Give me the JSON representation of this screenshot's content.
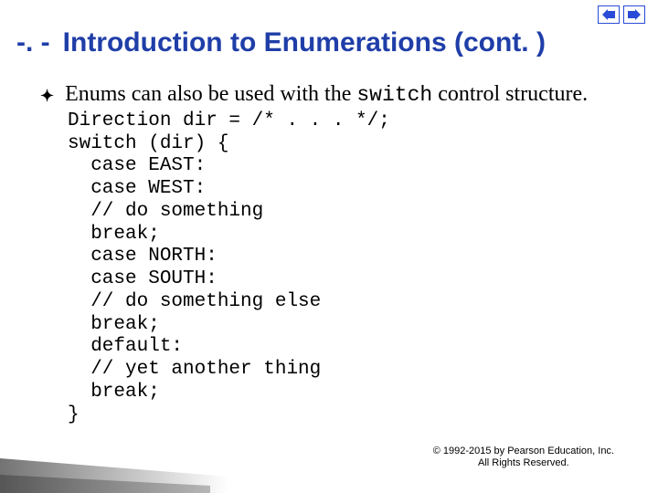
{
  "nav": {
    "prev_icon": "nav-prev-icon",
    "next_icon": "nav-next-icon"
  },
  "title": {
    "number": "-. -",
    "text": "Introduction to Enumerations (cont. )"
  },
  "bullet": {
    "symbol": "✦",
    "pre": "Enums can also be used with the ",
    "code_word": "switch",
    "post": " control structure."
  },
  "code": "Direction dir = /* . . . */;\nswitch (dir) {\n  case EAST:\n  case WEST:\n  // do something\n  break;\n  case NORTH:\n  case SOUTH:\n  // do something else\n  break;\n  default:\n  // yet another thing\n  break;\n}",
  "footer": {
    "line1": "© 1992-2015 by Pearson Education, Inc.",
    "line2": "All Rights Reserved."
  }
}
